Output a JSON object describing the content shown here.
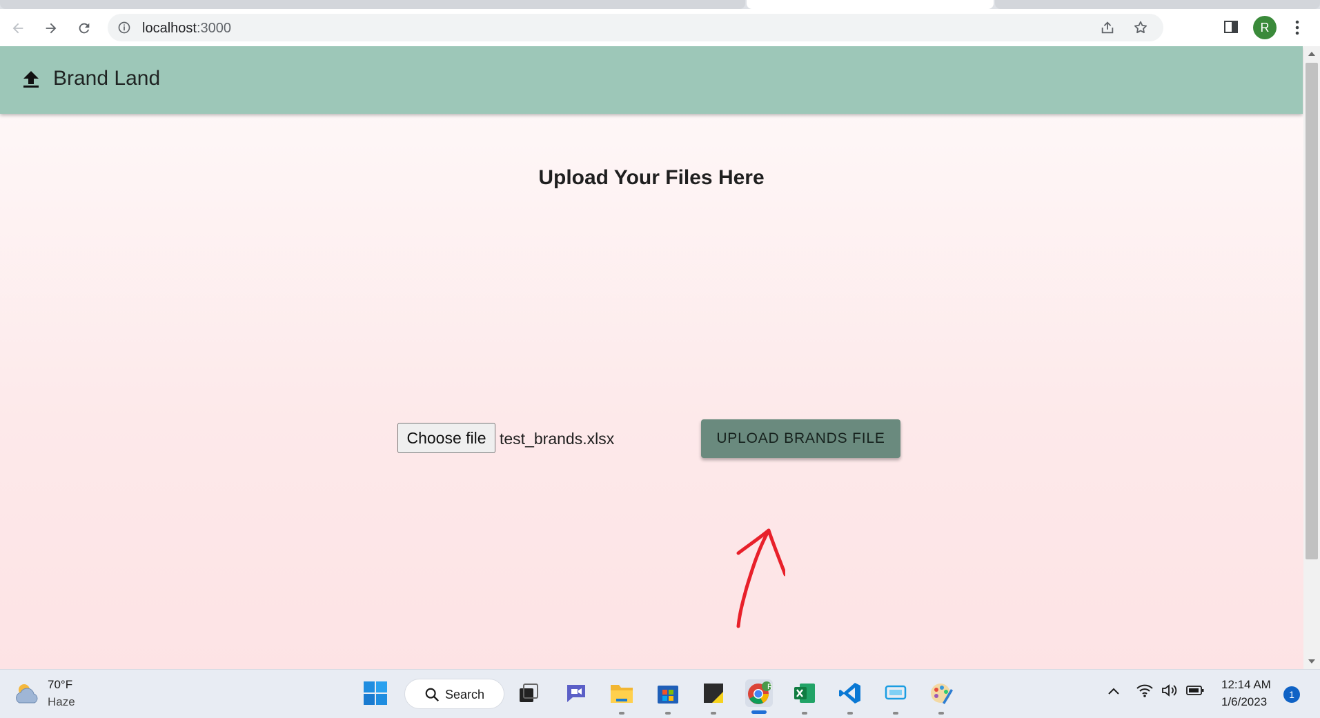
{
  "browser": {
    "url_host": "localhost",
    "url_port": ":3000",
    "profile_initial": "R"
  },
  "app": {
    "brand": "Brand Land",
    "heading": "Upload Your Files Here",
    "choose_file_label": "Choose file",
    "selected_file": "test_brands.xlsx",
    "upload_button_label": "UPLOAD BRANDS FILE",
    "header_color": "#9dc7b8",
    "button_color": "#6a8a7e",
    "annotation_color": "#e8202a"
  },
  "taskbar": {
    "weather_temp": "70°F",
    "weather_desc": "Haze",
    "search_label": "Search",
    "chrome_badge": "R",
    "time": "12:14 AM",
    "date": "1/6/2023",
    "notification_count": "1",
    "apps": [
      "start-icon",
      "search",
      "task-view-icon",
      "teams-chat-icon",
      "file-explorer-icon",
      "microsoft-store-icon",
      "sticky-notes-icon",
      "chrome-icon",
      "excel-icon",
      "vscode-icon",
      "app-icon",
      "paint-icon"
    ]
  }
}
